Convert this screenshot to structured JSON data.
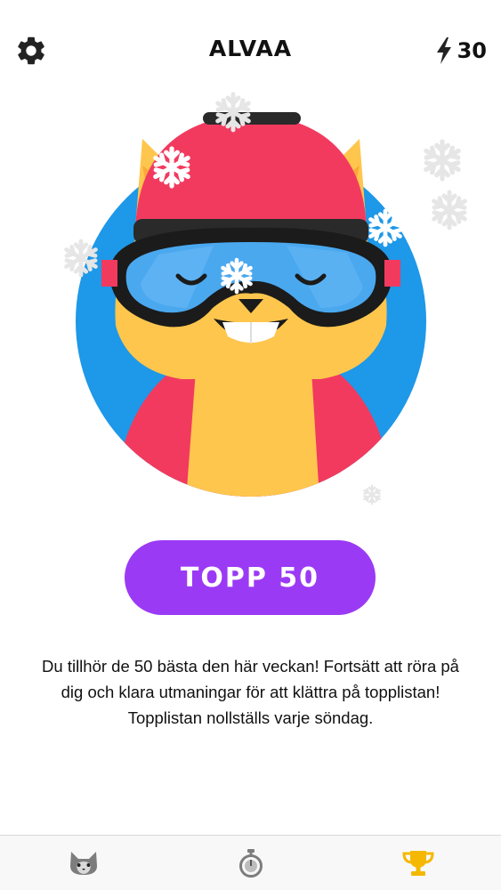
{
  "header": {
    "title": "ALVAA",
    "energy_count": "30"
  },
  "main": {
    "button_label": "TOPP 50",
    "description": "Du tillhör de 50 bästa den här veckan! Fortsätt att röra på dig och klara utmaningar för att klättra på topplistan! Topplistan nollställs varje söndag."
  },
  "tabs": [
    {
      "icon": "husky-icon",
      "active": false
    },
    {
      "icon": "stopwatch-icon",
      "active": false
    },
    {
      "icon": "trophy-icon",
      "active": true
    }
  ],
  "colors": {
    "accent": "#9b3af5",
    "circle_bg": "#1e98e8",
    "helmet": "#f23a5f",
    "fur": "#ffc64d",
    "trophy": "#f5b800"
  }
}
